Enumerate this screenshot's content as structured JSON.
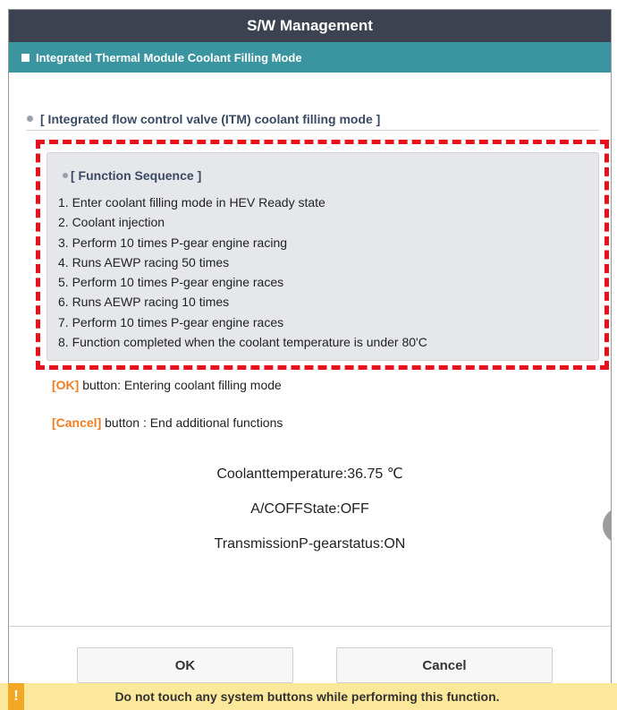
{
  "window": {
    "title": "S/W Management"
  },
  "subheader": {
    "title": "Integrated Thermal Module Coolant Filling Mode"
  },
  "section": {
    "title": "[ Integrated flow control valve (ITM) coolant filling mode ]"
  },
  "function_sequence": {
    "title": "[ Function Sequence ]",
    "steps": [
      "1. Enter coolant filling mode in HEV Ready state",
      "2. Coolant injection",
      "3. Perform 10 times P-gear engine racing",
      "4. Runs AEWP racing 50 times",
      "5. Perform 10 times P-gear engine races",
      "6. Runs AEWP racing 10 times",
      "7. Perform 10 times P-gear engine races",
      "8. Function completed when the coolant temperature is under 80'C"
    ]
  },
  "notes": {
    "ok_key": "[OK]",
    "ok_text": " button: Entering coolant filling mode",
    "cancel_key": "[Cancel]",
    "cancel_text": " button : End additional functions"
  },
  "status": {
    "coolant_temperature": "Coolanttemperature:36.75 ℃",
    "ac_state": "A/COFFState:OFF",
    "transmission": "TransmissionP-gearstatus:ON"
  },
  "buttons": {
    "ok": "OK",
    "cancel": "Cancel"
  },
  "warning": {
    "icon": "!",
    "text": "Do not touch any system buttons while performing this function."
  },
  "colors": {
    "titlebar": "#3c4250",
    "subheader": "#3a95a0",
    "highlight_frame": "#e8101a",
    "key_orange": "#f07d23",
    "warning_bg": "#fbe89a",
    "warning_icon": "#f2a826"
  }
}
